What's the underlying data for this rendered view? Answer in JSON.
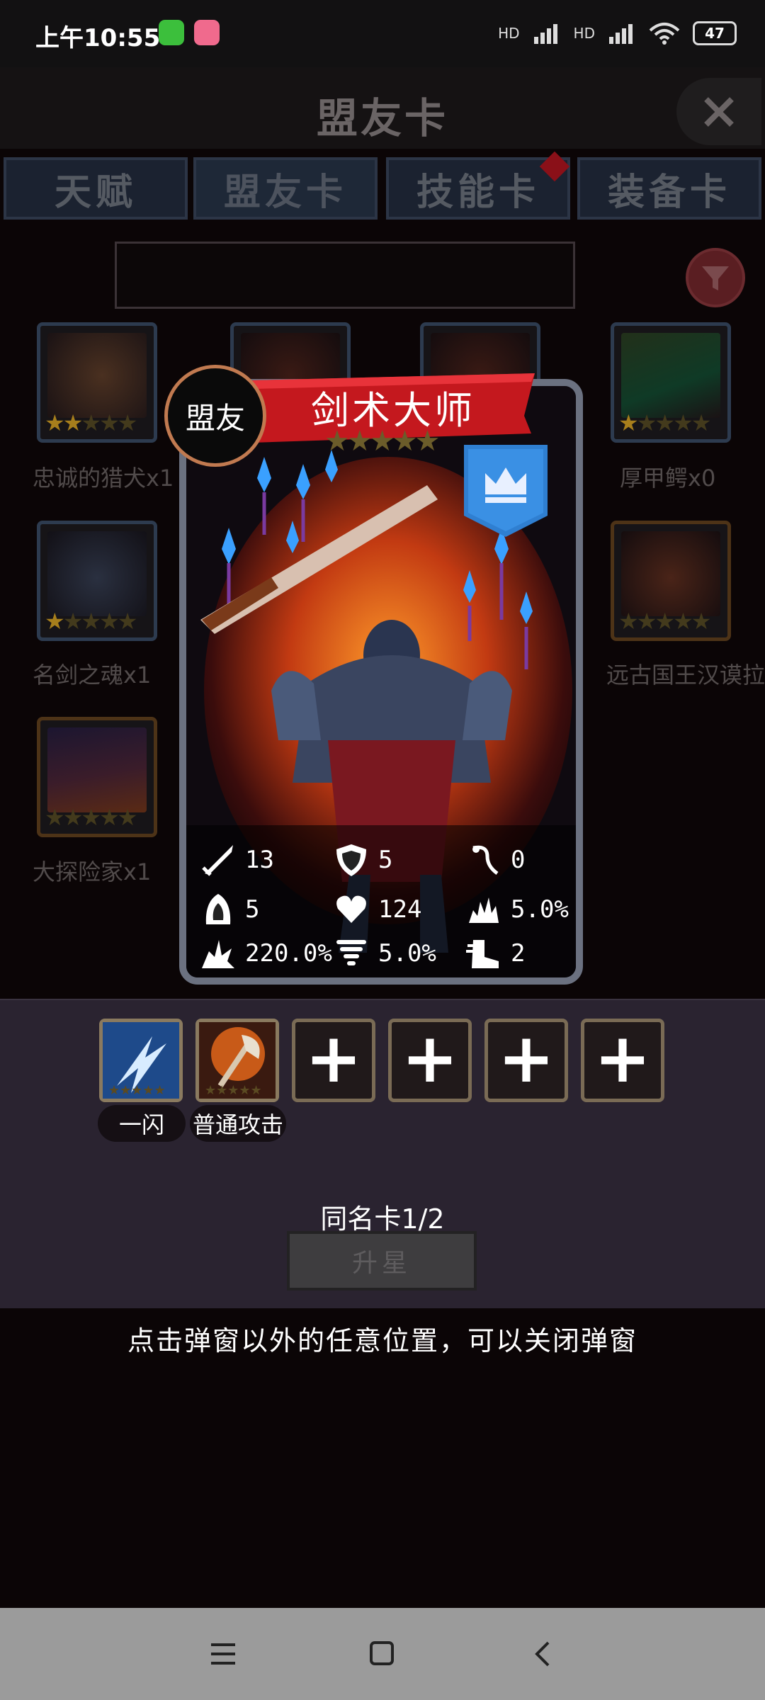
{
  "status_bar": {
    "time": "上午10:55",
    "signal_1": "HD",
    "signal_2": "HD",
    "battery": "47"
  },
  "header": {
    "title": "盟友卡"
  },
  "tabs": [
    {
      "label": "天赋",
      "active": false
    },
    {
      "label": "盟友卡",
      "active": true
    },
    {
      "label": "技能卡",
      "active": false,
      "badge": true
    },
    {
      "label": "装备卡",
      "active": false
    }
  ],
  "search": {
    "placeholder": ""
  },
  "allies": [
    {
      "name": "忠诚的猎犬x1",
      "stars_filled": 2
    },
    {
      "name": "厚甲鳄x0",
      "stars_filled": 1
    },
    {
      "name": "名剑之魂x1",
      "stars_filled": 1
    },
    {
      "name": "远古国王汉谟拉",
      "stars_filled": 0
    },
    {
      "name": "大探险家x1",
      "stars_filled": 0
    }
  ],
  "card": {
    "badge": "盟友",
    "name": "剑术大师",
    "stars_filled": 0,
    "stars_total": 5,
    "stats": {
      "attack": "13",
      "armor": "5",
      "crit_hit": "0",
      "speed": "5",
      "health": "124",
      "crit_rate": "5.0%",
      "crit_damage": "220.0%",
      "dodge": "5.0%",
      "move": "2"
    }
  },
  "skills": [
    {
      "label": "一闪",
      "stars": "★★★★★"
    },
    {
      "label": "普通攻击",
      "stars": "★★★★★"
    }
  ],
  "empty_slots": [
    "+",
    "+",
    "+",
    "+"
  ],
  "duplicate_text": "同名卡1/2",
  "upgrade_button": "升星",
  "close_hint": "点击弹窗以外的任意位置，可以关闭弹窗",
  "colors": {
    "background": "#0b0506",
    "panel": "#2a2330",
    "banner_red": "#c4181e",
    "crest_blue": "#2f7fd1",
    "star_gold": "#a67e1c"
  }
}
